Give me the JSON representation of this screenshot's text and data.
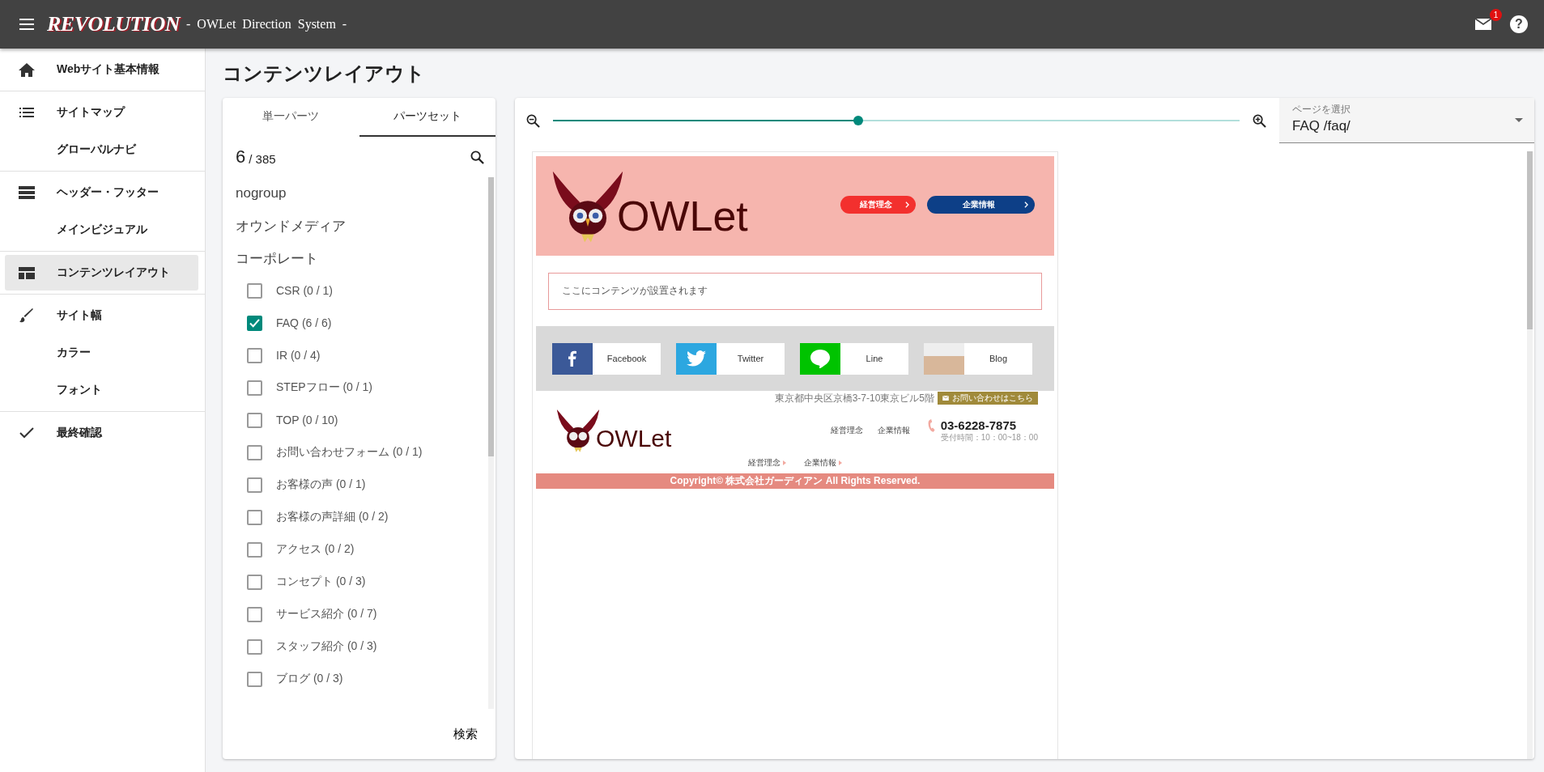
{
  "app_bar": {
    "logo": "REVOLUTION",
    "subtitle": "- OWLet Direction System -",
    "notification_count": "1",
    "help_icon": "?"
  },
  "sidebar": {
    "groups": [
      {
        "items": [
          {
            "label": "Webサイト基本情報",
            "selected": false
          }
        ]
      },
      {
        "items": [
          {
            "label": "サイトマップ",
            "selected": false
          },
          {
            "label": "グローバルナビ",
            "selected": false
          }
        ]
      },
      {
        "items": [
          {
            "label": "ヘッダー・フッター",
            "selected": false
          },
          {
            "label": "メインビジュアル",
            "selected": false
          }
        ]
      },
      {
        "items": [
          {
            "label": "コンテンツレイアウト",
            "selected": true
          }
        ]
      },
      {
        "items": [
          {
            "label": "サイト幅",
            "selected": false
          },
          {
            "label": "カラー",
            "selected": false
          },
          {
            "label": "フォント",
            "selected": false
          }
        ]
      },
      {
        "items": [
          {
            "label": "最終確認",
            "selected": false
          }
        ]
      }
    ]
  },
  "page_title": "コンテンツレイアウト",
  "parts_panel": {
    "tabs": [
      {
        "label": "単一パーツ",
        "selected": false
      },
      {
        "label": "パーツセット",
        "selected": true
      }
    ],
    "count": "6",
    "total": "/ 385",
    "groups": [
      "nogroup",
      "オウンドメディア",
      "コーポレート"
    ],
    "items": [
      {
        "label": "CSR (0 / 1)",
        "checked": false
      },
      {
        "label": "FAQ (6 / 6)",
        "checked": true
      },
      {
        "label": "IR (0 / 4)",
        "checked": false
      },
      {
        "label": "STEPフロー (0 / 1)",
        "checked": false
      },
      {
        "label": "TOP (0 / 10)",
        "checked": false
      },
      {
        "label": "お問い合わせフォーム (0 / 1)",
        "checked": false
      },
      {
        "label": "お客様の声 (0 / 1)",
        "checked": false
      },
      {
        "label": "お客様の声詳細 (0 / 2)",
        "checked": false
      },
      {
        "label": "アクセス (0 / 2)",
        "checked": false
      },
      {
        "label": "コンセプト (0 / 3)",
        "checked": false
      },
      {
        "label": "サービス紹介 (0 / 7)",
        "checked": false
      },
      {
        "label": "スタッフ紹介 (0 / 3)",
        "checked": false
      },
      {
        "label": "ブログ (0 / 3)",
        "checked": false
      }
    ],
    "search_button": "検索"
  },
  "preview": {
    "zoom": {
      "level": 0.444
    },
    "page_select": {
      "label": "ページを選択",
      "value": "FAQ /faq/"
    },
    "site": {
      "logo": "OWLet",
      "footer_logo": "OWLet",
      "header_buttons": [
        {
          "label": "経営理念",
          "color": "#f3302e"
        },
        {
          "label": "企業情報",
          "color": "#0d3f87"
        }
      ],
      "content_placeholder": "ここにコンテンツが設置されます",
      "social_links": [
        {
          "label": "Facebook",
          "kind": "facebook"
        },
        {
          "label": "Twitter",
          "kind": "twitter"
        },
        {
          "label": "Line",
          "kind": "line"
        },
        {
          "label": "Blog",
          "kind": "blog"
        }
      ],
      "address": "東京都中央区京橋3-7-10東京ビル5階",
      "contact_button": "お問い合わせはこちら",
      "footer_nav": [
        "経営理念",
        "企業情報"
      ],
      "phone": "03-6228-7875",
      "hours": "受付時間：10：00~18：00",
      "bottom_nav": [
        "経営理念",
        "企業情報"
      ],
      "copyright": "Copyright© 株式会社ガーディアン All Rights Reserved."
    }
  }
}
